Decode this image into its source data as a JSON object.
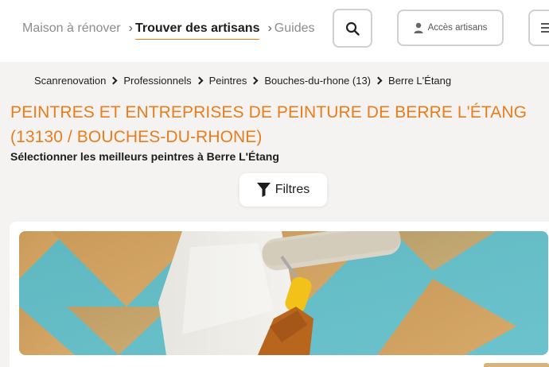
{
  "header": {
    "nav": [
      {
        "label": "Maison à rénover"
      },
      {
        "label": "Trouver des artisans"
      },
      {
        "label": "Guides"
      }
    ],
    "pro_button_label": "Accès artisans",
    "icons": {
      "search": "search-icon",
      "user": "user-icon",
      "menu": "menu-icon"
    }
  },
  "breadcrumb": [
    {
      "label": "Scanrenovation"
    },
    {
      "label": "Professionnels"
    },
    {
      "label": "Peintres"
    },
    {
      "label": "Bouches-du-rhone (13)"
    },
    {
      "label": "Berre L'Étang"
    }
  ],
  "page": {
    "title": "PEINTRES ET ENTREPRISES DE PEINTURE DE BERRE L'ÉTANG (13130 / BOUCHES-DU-RHONE)",
    "subtitle": "Sélectionner les meilleurs peintres à Berre L'Étang"
  },
  "filter": {
    "label": "Filtres",
    "icon": "filter-icon"
  },
  "colors": {
    "accent": "#e87d1e",
    "text": "#1d1d1d",
    "background": "#f4f3f1"
  }
}
